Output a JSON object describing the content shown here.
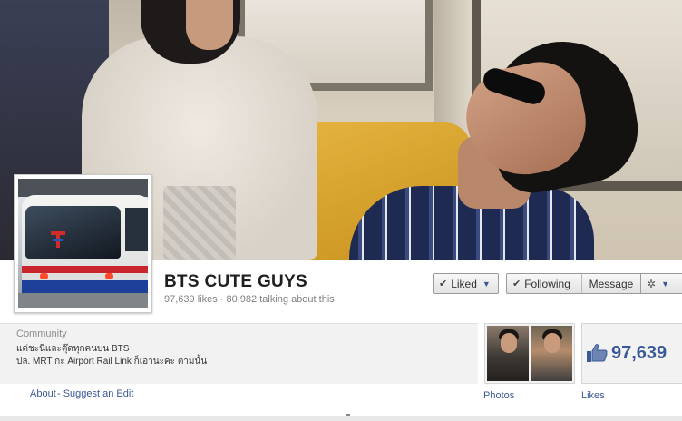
{
  "page": {
    "name": "BTS CUTE GUYS",
    "likes_text": "97,639 likes",
    "separator": "·",
    "talking_text": "80,982 talking about this"
  },
  "actions": {
    "liked_label": "Liked",
    "following_label": "Following",
    "message_label": "Message"
  },
  "info": {
    "category": "Community",
    "description_line1": "แด่ชะนีและตุ๊ดทุกคนบน BTS",
    "description_line2": "ปล. MRT กะ Airport Rail Link ก็เอานะคะ ตามนั้น",
    "about_label": "About",
    "suggest_label": "- Suggest an Edit"
  },
  "apps": {
    "photos_label": "Photos",
    "likes_label": "Likes",
    "likes_count": "97,639"
  },
  "icons": {
    "check": "check-icon",
    "caret": "caret-down-icon",
    "gear": "gear-icon",
    "thumb": "thumbs-up-icon"
  },
  "colors": {
    "link": "#3b5998",
    "name": "#1f1f1f",
    "muted": "#808080",
    "info_bg": "#f2f2f2"
  }
}
